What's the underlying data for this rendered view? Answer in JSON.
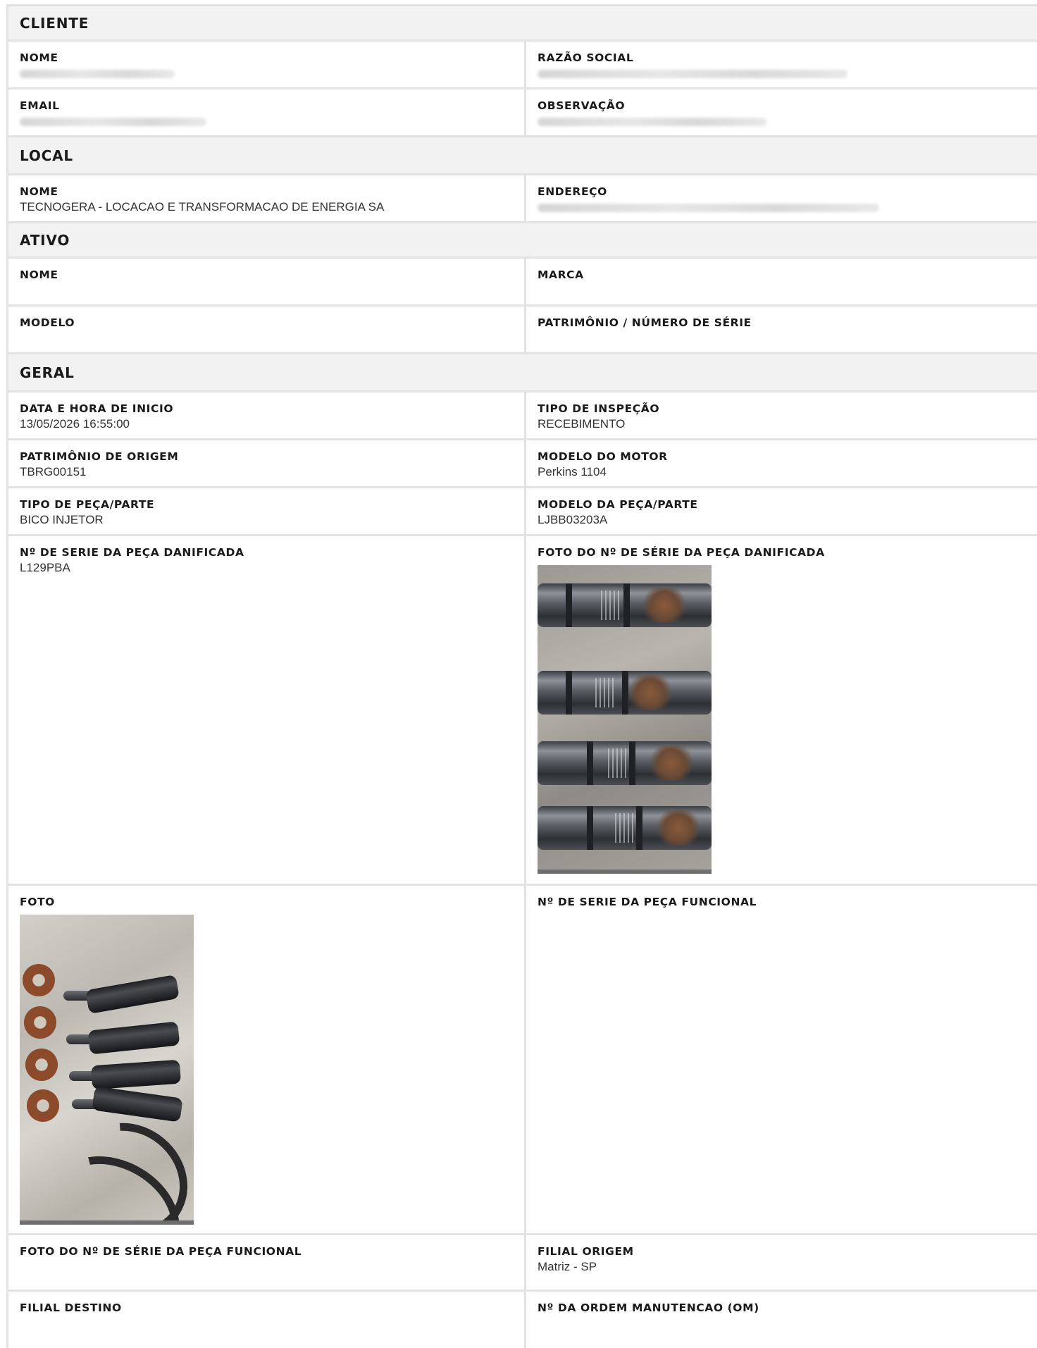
{
  "cliente": {
    "title": "CLIENTE",
    "nome_label": "NOME",
    "razao_social_label": "RAZÃO SOCIAL",
    "email_label": "EMAIL",
    "observacao_label": "OBSERVAÇÃO"
  },
  "local": {
    "title": "LOCAL",
    "nome_label": "NOME",
    "nome_value": "TECNOGERA - LOCACAO E TRANSFORMACAO DE ENERGIA SA",
    "endereco_label": "ENDEREÇO"
  },
  "ativo": {
    "title": "ATIVO",
    "nome_label": "NOME",
    "marca_label": "MARCA",
    "modelo_label": "MODELO",
    "patrimonio_label": "PATRIMÔNIO / NÚMERO DE SÉRIE"
  },
  "geral": {
    "title": "GERAL",
    "data_inicio_label": "DATA E HORA DE INICIO",
    "data_inicio_value": "13/05/2026 16:55:00",
    "tipo_inspecao_label": "TIPO DE INSPEÇÃO",
    "tipo_inspecao_value": "RECEBIMENTO",
    "patrimonio_origem_label": "PATRIMÔNIO DE ORIGEM",
    "patrimonio_origem_value": "TBRG00151",
    "modelo_motor_label": "MODELO DO MOTOR",
    "modelo_motor_value": "Perkins 1104",
    "tipo_peca_label": "TIPO DE PEÇA/PARTE",
    "tipo_peca_value": "BICO INJETOR",
    "modelo_peca_label": "MODELO DA PEÇA/PARTE",
    "modelo_peca_value": "LJBB03203A",
    "serie_danificada_label": "Nº DE SERIE DA PEÇA DANIFICADA",
    "serie_danificada_value": "L129PBA",
    "foto_serie_danificada_label": "FOTO DO Nº DE SÉRIE DA PEÇA DANIFICADA",
    "foto_label": "FOTO",
    "serie_funcional_label": "Nº DE SERIE DA PEÇA FUNCIONAL",
    "foto_serie_funcional_label": "FOTO DO Nº DE SÉRIE DA PEÇA FUNCIONAL",
    "filial_origem_label": "FILIAL ORIGEM",
    "filial_origem_value": "Matriz - SP",
    "filial_destino_label": "FILIAL DESTINO",
    "ordem_manutencao_label": "Nº DA ORDEM MANUTENCAO (OM)"
  }
}
